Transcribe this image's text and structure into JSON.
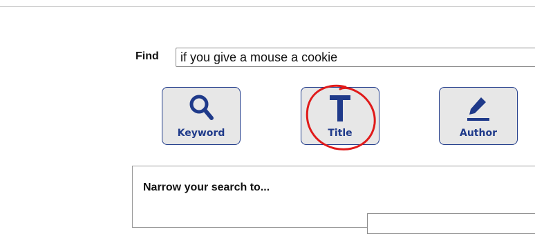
{
  "search": {
    "find_label": "Find",
    "query_value": "if you give a mouse a cookie"
  },
  "buttons": [
    {
      "label": "Keyword",
      "icon": "magnifier-icon"
    },
    {
      "label": "Title",
      "icon": "title-t-icon"
    },
    {
      "label": "Author",
      "icon": "pencil-icon"
    }
  ],
  "annotation": {
    "color": "#e01a1a",
    "target": "Title"
  },
  "narrow": {
    "title": "Narrow your search to..."
  },
  "colors": {
    "button_accent": "#1f3a8a",
    "button_fill": "#e7e7e7"
  }
}
